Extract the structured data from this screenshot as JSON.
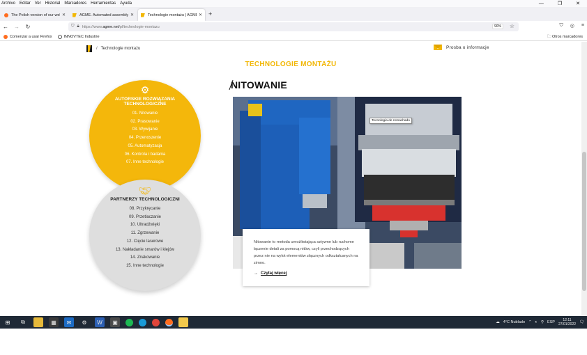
{
  "menubar": {
    "items": [
      "Archivo",
      "Editar",
      "Ver",
      "Historial",
      "Marcadores",
      "Herramientas",
      "Ayuda"
    ]
  },
  "tabs": [
    {
      "label": "The Polish version of our websi",
      "favicon": "firefox",
      "active": false
    },
    {
      "label": "AGME. Automated assembly m",
      "favicon": "agme",
      "active": false
    },
    {
      "label": "Technologie montażu | AGME",
      "favicon": "agme",
      "active": true
    }
  ],
  "nav": {
    "url_scheme": "https://www.",
    "url_domain": "agme.net",
    "url_path": "/pl/technologie-montazu",
    "zoom": "90%"
  },
  "bookmarks": {
    "items": [
      {
        "label": "Comenzar a usar Firefox",
        "icon": "firefox-icon"
      },
      {
        "label": "INNOVTEC Industrie",
        "icon": "globe-icon"
      }
    ],
    "other": "Otros marcadores"
  },
  "page": {
    "breadcrumb_sep": "/",
    "breadcrumb": "Technologie montażu",
    "info_link": "Prosba o informacje",
    "title": "TECHNOLOGIE MONTAŻU",
    "circle1": {
      "title": "AUTORSKIE ROZWIĄZANIA TECHNOLOGICZNE",
      "items": [
        "01. Nitowanie",
        "02. Prasowanie",
        "03. Wywijanie",
        "04. Przenoszenie",
        "05. Automatyzacja",
        "06. Kontrola i badania",
        "07. Inne technologie"
      ]
    },
    "circle2": {
      "title": "PARTNERZY TECHNOLOGICZNI",
      "items": [
        "08. Przykręcanie",
        "09. Przetłaczanie",
        "10. Ultradźwięki",
        "11. Zgrzewanie",
        "12. Cięcie laserowe",
        "13. Nakładanie smarów i klejów",
        "14. Znakowanie",
        "15. Inne technologie"
      ]
    },
    "section_heading": "NITOWANIE",
    "tooltip": "Tecnologia de remachado",
    "card_text": "Nitowanie to metoda umożliwiająca sztywne lub ruchome łączenie detali za pomocą nitów, czyli przechodzących przez nie na wylot elementów złącznych odkształcanych na zimno.",
    "card_arrow": "→",
    "card_link": "Czytaj więcej"
  },
  "taskbar": {
    "weather": "4°C  Nublado",
    "lang": "ESP",
    "time": "12:11",
    "date": "27/01/2022"
  }
}
